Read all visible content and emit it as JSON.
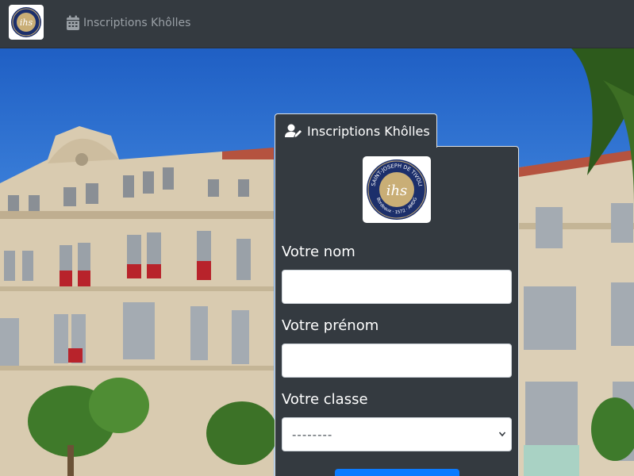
{
  "navbar": {
    "brand_logo_text": "ihs",
    "link_label": "Inscriptions Khôlles"
  },
  "form": {
    "tab_label": "Inscriptions Khôlles",
    "logo": {
      "center_text": "ihs",
      "ring_text_top": "SAINT-JOSEPH DE TIVOLI",
      "ring_text_bottom": "Bordeaux · 1572 · AMDG"
    },
    "nom_label": "Votre nom",
    "nom_value": "",
    "prenom_label": "Votre prénom",
    "prenom_value": "",
    "classe_label": "Votre classe",
    "classe_selected": "--------"
  },
  "colors": {
    "navbar_bg": "#343a40",
    "card_bg": "#343a40",
    "primary_button": "#0b7bff",
    "logo_navy": "#1c2f6b",
    "logo_gold": "#c9ae76"
  }
}
